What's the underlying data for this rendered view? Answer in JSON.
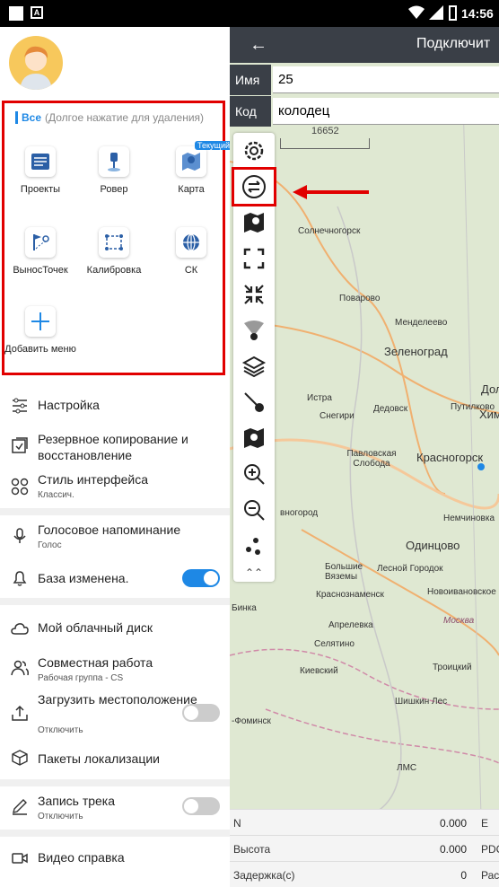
{
  "status_bar": {
    "time": "14:56"
  },
  "map_panel": {
    "back_icon": "arrow-left-icon",
    "title": "Подключит",
    "name_label": "Имя",
    "name_value": "25",
    "code_label": "Код",
    "code_value": "колодец",
    "scale_label": "16652",
    "labels": [
      "Солнечногорск",
      "Поварово",
      "Менделеево",
      "Зеленоград",
      "Истра",
      "Снегири",
      "Дедовск",
      "Путилково",
      "Павловская Слобода",
      "Красногорск",
      "Химк",
      "Дол",
      "Немчиновка",
      "Одинцово",
      "Большие Вяземы",
      "Лесной Городок",
      "Краснознаменск",
      "Новоивановское",
      "Апрелевка",
      "Москва",
      "Селятино",
      "Троицкий",
      "Киевский",
      "Шишкин Лес",
      "-Фоминск",
      "ЛМС",
      "вногород",
      "Бинка"
    ],
    "info_rows": [
      {
        "key": "N",
        "value": "0.000",
        "extra": "E"
      },
      {
        "key": "Высота",
        "value": "0.000",
        "extra": "PDC"
      },
      {
        "key": "Задержка(с)",
        "value": "0",
        "extra": "Рас"
      }
    ],
    "accent_color": "#e10000"
  },
  "drawer": {
    "all_label": "Все",
    "all_hint": "(Долгое нажатие для удаления)",
    "grid": [
      {
        "label": "Проекты",
        "icon": "projects-icon"
      },
      {
        "label": "Ровер",
        "icon": "rover-icon"
      },
      {
        "label": "Карта",
        "icon": "map-icon",
        "badge": "Текущий"
      },
      {
        "label": "ВыносТочек",
        "icon": "stakeout-icon"
      },
      {
        "label": "Калибровка",
        "icon": "calibration-icon"
      },
      {
        "label": "СК",
        "icon": "coordinate-system-icon"
      },
      {
        "label": "Добавить меню",
        "icon": "add-icon"
      }
    ],
    "menu": {
      "settings": "Настройка",
      "backup": "Резервное копирование и восстановление",
      "style": "Стиль интерфейса",
      "style_sub": "Классич.",
      "voice": "Голосовое напоминание",
      "voice_sub": "Голос",
      "base_changed": "База изменена.",
      "cloud": "Мой облачный диск",
      "collab": "Совместная работа",
      "collab_sub": "Рабочая группа - CS",
      "upload_loc": "Загрузить местоположение",
      "upload_loc_sub": "Отключить",
      "loc_packs": "Пакеты локализации",
      "track": "Запись трека",
      "track_sub": "Отключить",
      "video": "Видео справка"
    }
  }
}
